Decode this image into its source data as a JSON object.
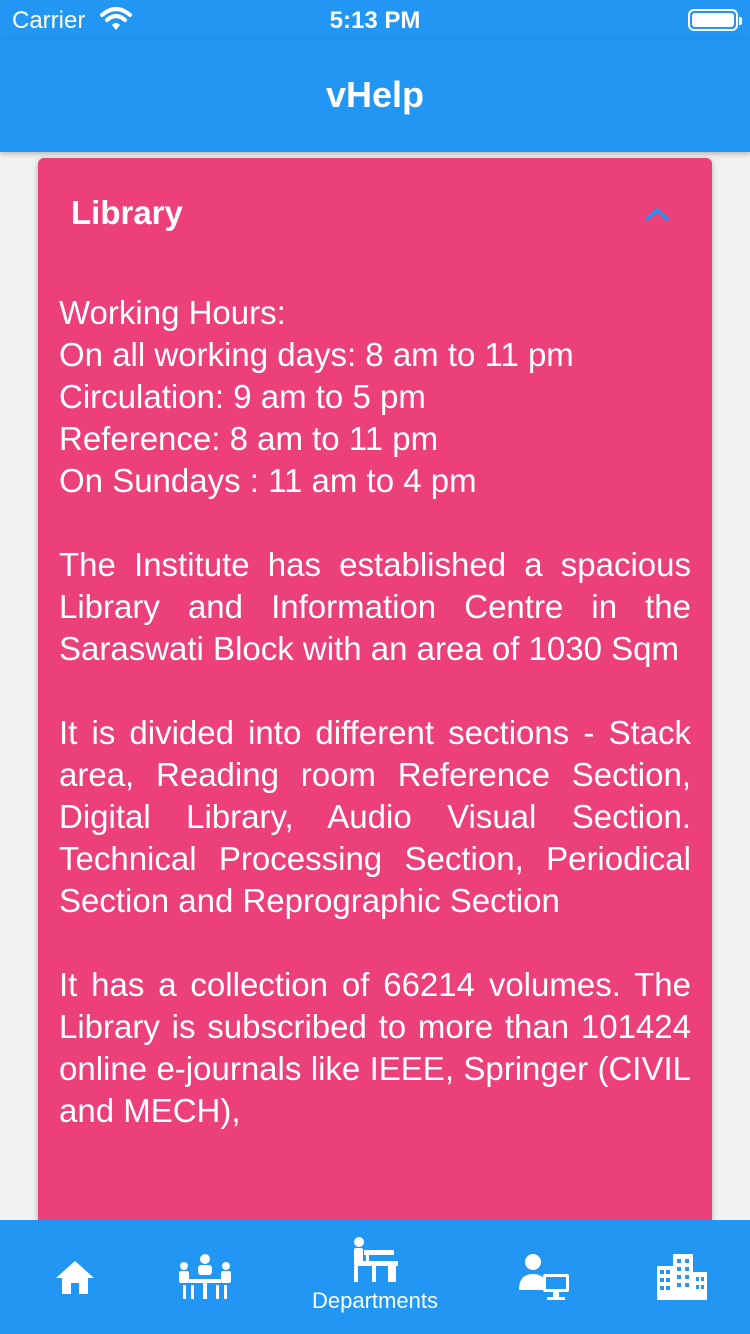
{
  "status": {
    "carrier": "Carrier",
    "time": "5:13 PM"
  },
  "app": {
    "title": "vHelp"
  },
  "card": {
    "title": "Library",
    "hours": [
      "Working Hours:",
      "On all working days: 8 am to 11 pm",
      "Circulation: 9 am to 5 pm",
      "Reference: 8 am to 11 pm",
      "On Sundays : 11 am to 4 pm"
    ],
    "paragraphs": [
      "The Institute has established a spacious Library and Information Centre in the Saraswati Block with an area of 1030 Sqm",
      "It is divided into different sections - Stack area, Reading room Reference Section, Digital Library, Audio Visual Section. Technical Processing Section, Periodical Section and Reprographic Section",
      "It has a collection of 66214 volumes. The Library is subscribed to more than 101424 online e-journals like IEEE, Springer (CIVIL and MECH),"
    ]
  },
  "tabs": [
    {
      "icon": "home-icon",
      "label": ""
    },
    {
      "icon": "meeting-icon",
      "label": ""
    },
    {
      "icon": "departments-icon",
      "label": "Departments"
    },
    {
      "icon": "user-computer-icon",
      "label": ""
    },
    {
      "icon": "buildings-icon",
      "label": ""
    }
  ],
  "colors": {
    "primary": "#2196f3",
    "card": "#ec407a",
    "background": "#f2f2f2",
    "chevron": "#2196f3"
  }
}
